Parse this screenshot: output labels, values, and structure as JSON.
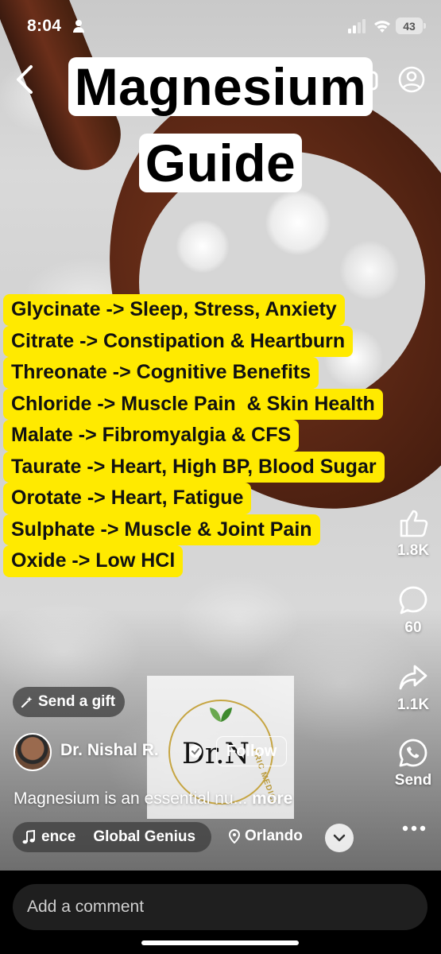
{
  "status_bar": {
    "time": "8:04",
    "battery": "43"
  },
  "title": {
    "line1": "Magnesium",
    "line2": "Guide"
  },
  "magnesium_types": [
    "Glycinate -> Sleep, Stress, Anxiety",
    "Citrate -> Constipation & Heartburn",
    "Threonate -> Cognitive Benefits",
    "Chloride -> Muscle Pain  & Skin Health",
    "Malate -> Fibromyalgia & CFS",
    "Taurate -> Heart, High BP, Blood Sugar",
    "Orotate -> Heart, Fatigue",
    "Sulphate -> Muscle & Joint Pain",
    "Oxide -> Low HCl"
  ],
  "actions": {
    "likes": "1.8K",
    "comments": "60",
    "shares": "1.1K",
    "send": "Send"
  },
  "gift": {
    "label": "Send a gift"
  },
  "logo": {
    "text": "Dr.N",
    "arc": "PRIC MEDICI"
  },
  "creator": {
    "name": "Dr. Nishal R.",
    "follow": "Follow"
  },
  "caption": {
    "text": "Magnesium is an essential nu...",
    "more": "more"
  },
  "audio": {
    "part1": "ence",
    "part2": "Global Genius"
  },
  "location": {
    "name": "Orlando"
  },
  "comment": {
    "placeholder": "Add a comment"
  },
  "colors": {
    "highlight": "#ffea00",
    "title_bg": "#ffffff"
  }
}
